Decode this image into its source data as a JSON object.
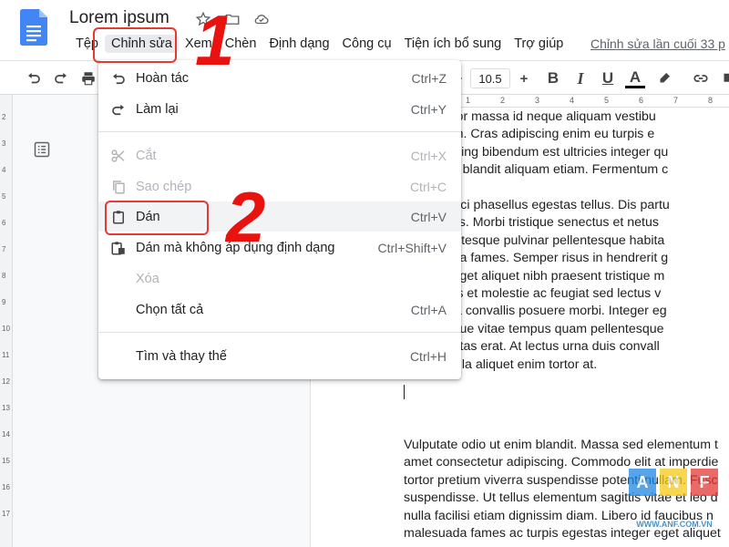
{
  "doc_title": "Lorem ipsum",
  "menubar": [
    {
      "label": "Tệp"
    },
    {
      "label": "Chỉnh sửa"
    },
    {
      "label": "Xem"
    },
    {
      "label": "Chèn"
    },
    {
      "label": "Định dạng"
    },
    {
      "label": "Công cụ"
    },
    {
      "label": "Tiện ích bổ sung"
    },
    {
      "label": "Trợ giúp"
    }
  ],
  "last_edit": "Chỉnh sửa lần cuối 33 p",
  "toolbar": {
    "font_size": "10.5",
    "minus": "−",
    "plus": "+",
    "bold": "B",
    "italic": "I",
    "underline": "U",
    "text_color": "A"
  },
  "edit_menu": {
    "items": [
      {
        "label": "Hoàn tác",
        "shortcut": "Ctrl+Z",
        "icon": "undo-icon",
        "disabled": false
      },
      {
        "label": "Làm lại",
        "shortcut": "Ctrl+Y",
        "icon": "redo-icon",
        "disabled": false
      },
      {
        "label": "Cắt",
        "shortcut": "Ctrl+X",
        "icon": "scissors-icon",
        "disabled": true
      },
      {
        "label": "Sao chép",
        "shortcut": "Ctrl+C",
        "icon": "copy-icon",
        "disabled": true
      },
      {
        "label": "Dán",
        "shortcut": "Ctrl+V",
        "icon": "clipboard-icon",
        "disabled": false
      },
      {
        "label": "Dán mà không áp dụng định dạng",
        "shortcut": "Ctrl+Shift+V",
        "icon": "paste-plain-icon",
        "disabled": false
      },
      {
        "label": "Xóa",
        "shortcut": "",
        "icon": "",
        "disabled": true
      },
      {
        "label": "Chọn tất cả",
        "shortcut": "Ctrl+A",
        "icon": "",
        "disabled": false
      },
      {
        "label": "Tìm và thay thế",
        "shortcut": "Ctrl+H",
        "icon": "",
        "disabled": false
      }
    ]
  },
  "annotations": {
    "step1": "1",
    "step2": "2"
  },
  "ruler": {
    "h": [
      "1",
      "2",
      "3",
      "4",
      "5",
      "6",
      "7",
      "8"
    ],
    "v": [
      "2",
      "3",
      "4",
      "5",
      "6",
      "7",
      "8",
      "9",
      "10",
      "11",
      "12",
      "13",
      "14",
      "15",
      "16",
      "17"
    ]
  },
  "doc_lines_1": [
    "ılla porttitor massa id neque aliquam vestibu",
    "vitae proin. Cras adipiscing enim eu turpis e",
    "bit adipiscing bibendum est ultricies integer qu",
    "s volutpat blandit aliquam etiam. Fermentum c",
    "",
    "udin ac orci phasellus egestas tellus. Dis partu",
    "ae ultricies. Morbi tristique senectus et netus",
    "oh. Pellentesque pulvinar pellentesque habita",
    "malesuada fames. Semper risus in hendrerit g",
    "re arcu. Eget aliquet nibh praesent tristique m",
    ". Faucibus et molestie ac feugiat sed lectus v",
    "s pharetra convallis posuere morbi. Integer eg",
    "urus. Neque vitae tempus quam pellentesque",
    "at in egestas erat. At lectus urna duis convall",
    "istique nulla aliquet enim tortor at."
  ],
  "doc_lines_2": [
    "Vulputate odio ut enim blandit. Massa sed elementum t",
    "amet consectetur adipiscing. Commodo elit at imperdie",
    "tortor pretium viverra suspendisse potenti nullam. Fusc",
    "suspendisse. Ut tellus elementum sagittis vitae et leo d",
    "nulla facilisi etiam dignissim diam. Libero id faucibus n",
    "malesuada fames ac turpis egestas integer eget aliquet"
  ],
  "watermark": {
    "letters": [
      "A",
      "N",
      "F"
    ],
    "text": "WWW.ANF.COM.VN",
    "colors": [
      "#1e88e5",
      "#f6c915",
      "#e53935"
    ]
  }
}
